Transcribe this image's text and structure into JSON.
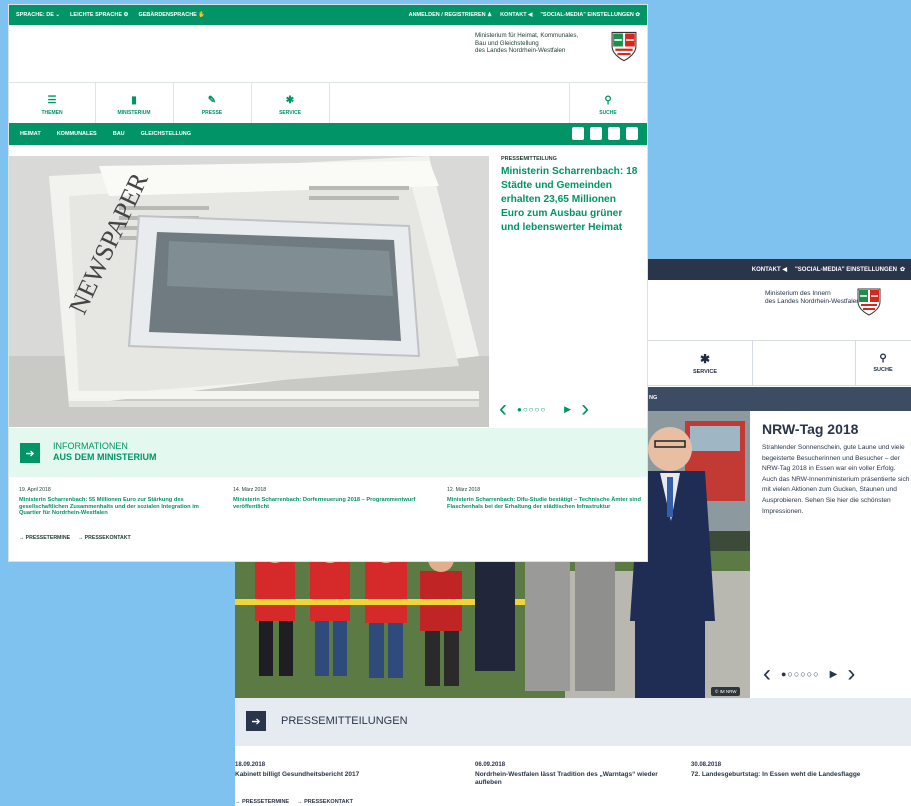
{
  "back_site": {
    "topbar": {
      "contact": "KONTAKT",
      "social": "\"SOCIAL-MEDIA\" EINSTELLUNGEN"
    },
    "logo_lines": [
      "Ministerium des Innern",
      "des Landes Nordrhein-Westfalen"
    ],
    "nav": {
      "service": "SERVICE",
      "search": "SUCHE"
    },
    "subnav_fragment": "NG",
    "hero_badge": "© IM NRW",
    "teaser": {
      "title": "NRW-Tag 2018",
      "text": "Strahlender Sonnenschein, gute Laune und viele begeisterte Besucherinnen und Besucher – der NRW-Tag 2018 in Essen war ein voller Erfolg. Auch das NRW-Innenministerium präsentierte sich mit vielen Aktionen zum Gucken, Staunen und Ausprobieren. Sehen Sie hier die schönsten Impressionen."
    },
    "section_title": "PRESSEMITTEILUNGEN",
    "news": [
      {
        "date": "18.09.2018",
        "title": "Kabinett billigt Gesundheitsbericht 2017"
      },
      {
        "date": "06.09.2018",
        "title": "Nordrhein-Westfalen lässt Tradition des „Warntags“ wieder aufleben"
      },
      {
        "date": "30.08.2018",
        "title": "72. Landesgeburtstag: In Essen weht die Landesflagge"
      }
    ],
    "links": [
      "PRESSETERMINE",
      "PRESSEKONTAKT"
    ]
  },
  "front_site": {
    "topbar": {
      "language": "SPRACHE: DE",
      "easy_language": "LEICHTE SPRACHE",
      "sign_language": "GEBÄRDENSPRACHE",
      "login": "ANMELDEN / REGISTRIEREN",
      "contact": "KONTAKT",
      "social": "\"SOCIAL-MEDIA\" EINSTELLUNGEN"
    },
    "logo_lines": [
      "Ministerium für Heimat, Kommunales,",
      "Bau und Gleichstellung",
      "des Landes Nordrhein-Westfalen"
    ],
    "nav": {
      "themen": "THEMEN",
      "ministerium": "MINISTERIUM",
      "presse": "PRESSE",
      "service": "SERVICE",
      "suche": "SUCHE"
    },
    "subnav": [
      "HEIMAT",
      "KOMMUNALES",
      "BAU",
      "GLEICHSTELLUNG"
    ],
    "teaser": {
      "kicker": "PRESSEMITTEILUNG",
      "title": "Ministerin Scharrenbach: 18 Städte und Gemeinden erhalten 23,65 Millionen Euro zum Ausbau grüner und lebenswerter Heimat"
    },
    "section_title_1": "INFORMATIONEN",
    "section_title_2": "AUS DEM MINISTERIUM",
    "news": [
      {
        "date": "19. April 2018",
        "title": "Ministerin Scharrenbach: 55 Millionen Euro zur Stärkung des gesellschaftlichen Zusammenhalts und der sozialen Integration im Quartier für Nordrhein-Westfalen"
      },
      {
        "date": "14. März 2018",
        "title": "Ministerin Scharrenbach: Dorferneuerung 2018 – Programmentwurf veröffentlicht"
      },
      {
        "date": "12. März 2018",
        "title": "Ministerin Scharrenbach: Difu-Studie bestätigt – Technische Ämter sind Flaschenhals bei der Erhaltung der städtischen Infrastruktur"
      }
    ],
    "links": [
      "PRESSETERMINE",
      "PRESSEKONTAKT"
    ]
  },
  "colors": {
    "front_accent": "#009467",
    "back_accent": "#28354a",
    "background": "#7fc2f0"
  }
}
